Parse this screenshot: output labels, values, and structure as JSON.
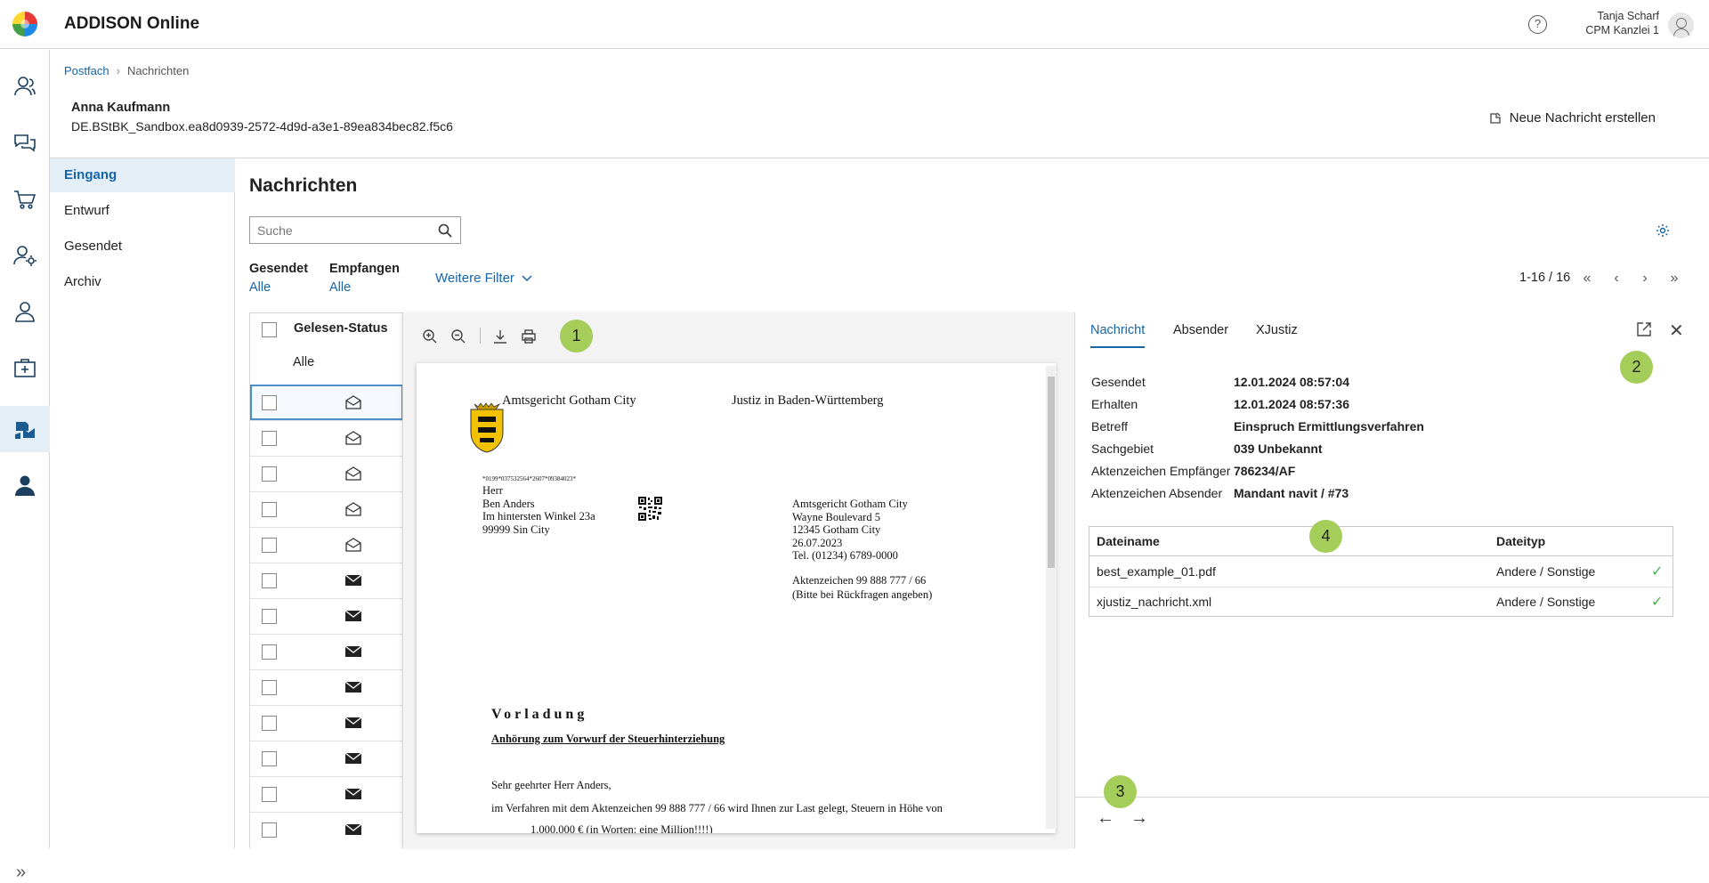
{
  "app": {
    "title": "ADDISON Online"
  },
  "user": {
    "name": "Tanja Scharf",
    "org": "CPM Kanzlei 1"
  },
  "breadcrumb": {
    "root": "Postfach",
    "current": "Nachrichten"
  },
  "client": {
    "name": "Anna Kaufmann",
    "id": "DE.BStBK_Sandbox.ea8d0939-2572-4d9d-a3e1-89ea834bec82.f5c6"
  },
  "actions": {
    "new_message": "Neue Nachricht erstellen"
  },
  "subnav": {
    "items": [
      "Eingang",
      "Entwurf",
      "Gesendet",
      "Archiv"
    ],
    "active": "Eingang"
  },
  "main": {
    "title": "Nachrichten",
    "search_placeholder": "Suche",
    "filters": [
      {
        "label": "Gesendet",
        "value": "Alle"
      },
      {
        "label": "Empfangen",
        "value": "Alle"
      }
    ],
    "more_filters": "Weitere Filter",
    "pagination": "1-16 / 16"
  },
  "table": {
    "header": "Gelesen-Status",
    "filter_value": "Alle",
    "rows": [
      {
        "status": "read"
      },
      {
        "status": "read"
      },
      {
        "status": "read"
      },
      {
        "status": "read"
      },
      {
        "status": "read"
      },
      {
        "status": "unread"
      },
      {
        "status": "unread"
      },
      {
        "status": "unread"
      },
      {
        "status": "unread"
      },
      {
        "status": "unread"
      },
      {
        "status": "unread"
      },
      {
        "status": "unread"
      },
      {
        "status": "unread"
      }
    ]
  },
  "document": {
    "court": "Amtsgericht Gotham City",
    "state": "Justiz in Baden-Württemberg",
    "barcode": "*0199*037532564*2607*09384023*",
    "recipient": [
      "Herr",
      "Ben Anders",
      "Im hintersten Winkel 23a",
      "99999 Sin City"
    ],
    "sender": [
      "Amtsgericht Gotham City",
      "Wayne Boulevard 5",
      "12345 Gotham City",
      "26.07.2023",
      "Tel. (01234) 6789-0000"
    ],
    "reference": [
      "Aktenzeichen 99 888 777 / 66",
      "(Bitte bei Rückfragen angeben)"
    ],
    "heading": "Vorladung",
    "subheading": "Anhörung zum Vorwurf der Steuerhinterziehung",
    "salutation": "Sehr geehrter Herr Anders,",
    "body1": "im Verfahren mit dem Aktenzeichen 99 888 777 / 66 wird Ihnen zur Last gelegt, Steuern in Höhe von",
    "body2": "1.000.000 € (in Worten: eine Million!!!!)"
  },
  "detail": {
    "tabs": [
      "Nachricht",
      "Absender",
      "XJustiz"
    ],
    "fields": [
      {
        "key": "Gesendet",
        "value": "12.01.2024 08:57:04"
      },
      {
        "key": "Erhalten",
        "value": "12.01.2024 08:57:36"
      },
      {
        "key": "Betreff",
        "value": "Einspruch Ermittlungsverfahren"
      },
      {
        "key": "Sachgebiet",
        "value": "039 Unbekannt"
      },
      {
        "key": "Aktenzeichen Empfänger",
        "value": "786234/AF"
      },
      {
        "key": "Aktenzeichen Absender",
        "value": "Mandant navit / #73"
      }
    ],
    "files_header": {
      "name": "Dateiname",
      "type": "Dateityp"
    },
    "files": [
      {
        "name": "best_example_01.pdf",
        "type": "Andere / Sonstige"
      },
      {
        "name": "xjustiz_nachricht.xml",
        "type": "Andere / Sonstige"
      }
    ]
  },
  "badges": [
    "1",
    "2",
    "3",
    "4"
  ],
  "colors": {
    "accent": "#1565a8",
    "badge": "#a5cd59",
    "active_bg": "#e3eef7",
    "check": "#4caf50"
  }
}
